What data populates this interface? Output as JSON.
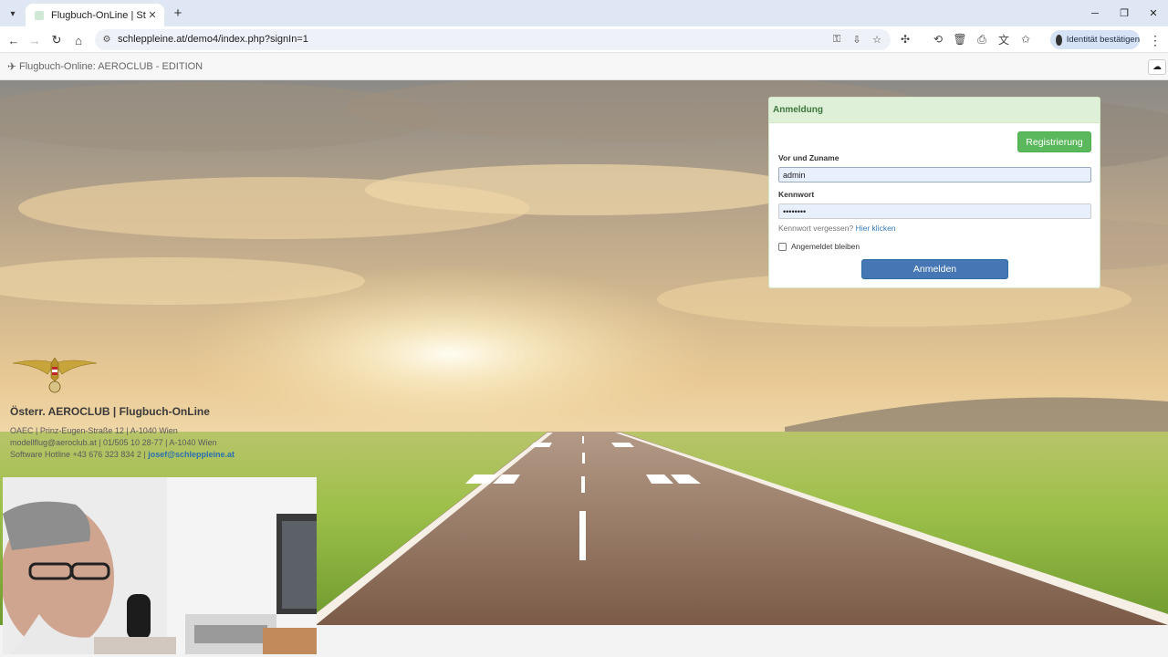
{
  "browser": {
    "tab_title": "Flugbuch-OnLine | Startseite",
    "url": "schleppleine.at/demo4/index.php?signIn=1",
    "identity_label": "Identität bestätigen"
  },
  "app": {
    "title": "Flugbuch-Online: AEROCLUB - EDITION"
  },
  "login": {
    "heading": "Anmeldung",
    "register_label": "Registrierung",
    "name_label": "Vor und Zuname",
    "name_value": "admin",
    "password_label": "Kennwort",
    "password_value": "••••••••",
    "forgot_text": "Kennwort vergessen?",
    "forgot_link": "Hier klicken",
    "remember_label": "Angemeldet bleiben",
    "submit_label": "Anmelden"
  },
  "club": {
    "name": "Österr. AEROCLUB | Flugbuch-OnLine",
    "address": "OAEC | Prinz-Eugen-Straße 12 | A-1040 Wien",
    "contact": "modellflug@aeroclub.at | 01/505 10 28-77 | A-1040 Wien",
    "hotline_prefix": "Software Hotline +43 676 323 834 2 |",
    "hotline_email": "josef@schleppleine.at"
  },
  "colors": {
    "panel_header_bg": "#dff0d8",
    "register_btn": "#5cb85c",
    "login_btn": "#4677b4",
    "link": "#337ab7"
  }
}
